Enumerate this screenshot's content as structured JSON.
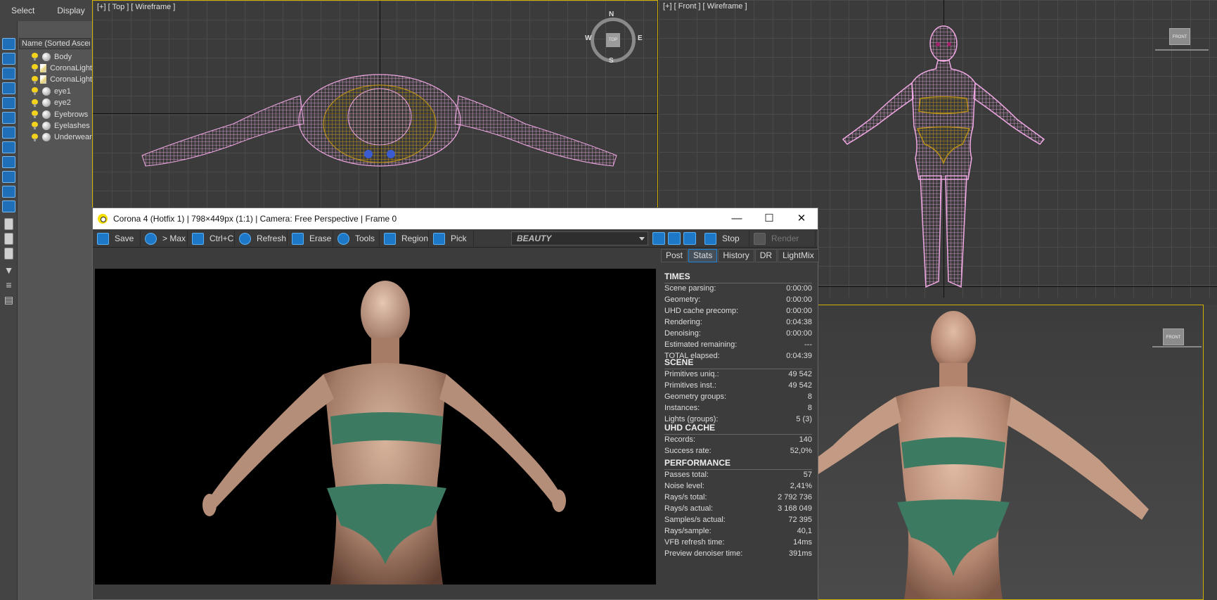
{
  "left_menu": {
    "select": "Select",
    "display": "Display"
  },
  "explorer": {
    "header": "Name (Sorted Ascending)",
    "items": [
      {
        "label": "Body",
        "type": "geometry"
      },
      {
        "label": "CoronaLight",
        "type": "light"
      },
      {
        "label": "CoronaLight",
        "type": "light"
      },
      {
        "label": "eye1",
        "type": "geometry"
      },
      {
        "label": "eye2",
        "type": "geometry"
      },
      {
        "label": "Eyebrows",
        "type": "geometry"
      },
      {
        "label": "Eyelashes",
        "type": "geometry"
      },
      {
        "label": "Underwear",
        "type": "geometry"
      }
    ]
  },
  "viewports": {
    "top": {
      "label": "[+] [ Top ] [ Wireframe ]",
      "compass": {
        "n": "N",
        "s": "S",
        "e": "E",
        "w": "W",
        "cube": "TOP"
      }
    },
    "front": {
      "label": "[+] [ Front ] [ Wireframe ]",
      "cube": "FRONT"
    },
    "persp": {
      "cube": "FRONT"
    }
  },
  "vfb": {
    "title": "Corona 4 (Hotfix 1) | 798×449px (1:1) | Camera: Free Perspective | Frame 0",
    "window_buttons": {
      "minimize": "—",
      "maximize": "☐",
      "close": "✕"
    },
    "toolbar": {
      "save": "Save",
      "to_max": "> Max",
      "copy": "Ctrl+C",
      "refresh": "Refresh",
      "erase": "Erase",
      "tools": "Tools",
      "region": "Region",
      "pick": "Pick",
      "channel": "BEAUTY",
      "stop": "Stop",
      "render": "Render"
    },
    "tabs": [
      "Post",
      "Stats",
      "History",
      "DR",
      "LightMix"
    ],
    "active_tab": "Stats",
    "stats": {
      "times": {
        "title": "TIMES",
        "rows": [
          {
            "label": "Scene parsing:",
            "value": "0:00:00"
          },
          {
            "label": "Geometry:",
            "value": "0:00:00"
          },
          {
            "label": "UHD cache precomp:",
            "value": "0:00:00"
          },
          {
            "label": "Rendering:",
            "value": "0:04:38"
          },
          {
            "label": "Denoising:",
            "value": "0:00:00"
          },
          {
            "label": "Estimated remaining:",
            "value": "---"
          },
          {
            "label": "TOTAL elapsed:",
            "value": "0:04:39"
          }
        ]
      },
      "scene": {
        "title": "SCENE",
        "rows": [
          {
            "label": "Primitives uniq.:",
            "value": "49 542"
          },
          {
            "label": "Primitives inst.:",
            "value": "49 542"
          },
          {
            "label": "Geometry groups:",
            "value": "8"
          },
          {
            "label": "Instances:",
            "value": "8"
          },
          {
            "label": "Lights (groups):",
            "value": "5 (3)"
          }
        ]
      },
      "uhd": {
        "title": "UHD CACHE",
        "rows": [
          {
            "label": "Records:",
            "value": "140"
          },
          {
            "label": "Success rate:",
            "value": "52,0%"
          }
        ]
      },
      "performance": {
        "title": "PERFORMANCE",
        "rows": [
          {
            "label": "Passes total:",
            "value": "57"
          },
          {
            "label": "Noise level:",
            "value": "2,41%"
          },
          {
            "label": "Rays/s total:",
            "value": "2 792 736"
          },
          {
            "label": "Rays/s actual:",
            "value": "3 168 049"
          },
          {
            "label": "Samples/s actual:",
            "value": "72 395"
          },
          {
            "label": "Rays/sample:",
            "value": "40,1"
          },
          {
            "label": "VFB refresh time:",
            "value": "14ms"
          },
          {
            "label": "Preview denoiser time:",
            "value": "391ms"
          }
        ]
      }
    }
  },
  "colors": {
    "wire_body": "#f0a8e4",
    "wire_underwear": "#b8901a",
    "accent": "#1f85d8",
    "viewport_active_border": "#d0b000",
    "skin": "#c9a08a",
    "garment": "#3d7a62"
  }
}
